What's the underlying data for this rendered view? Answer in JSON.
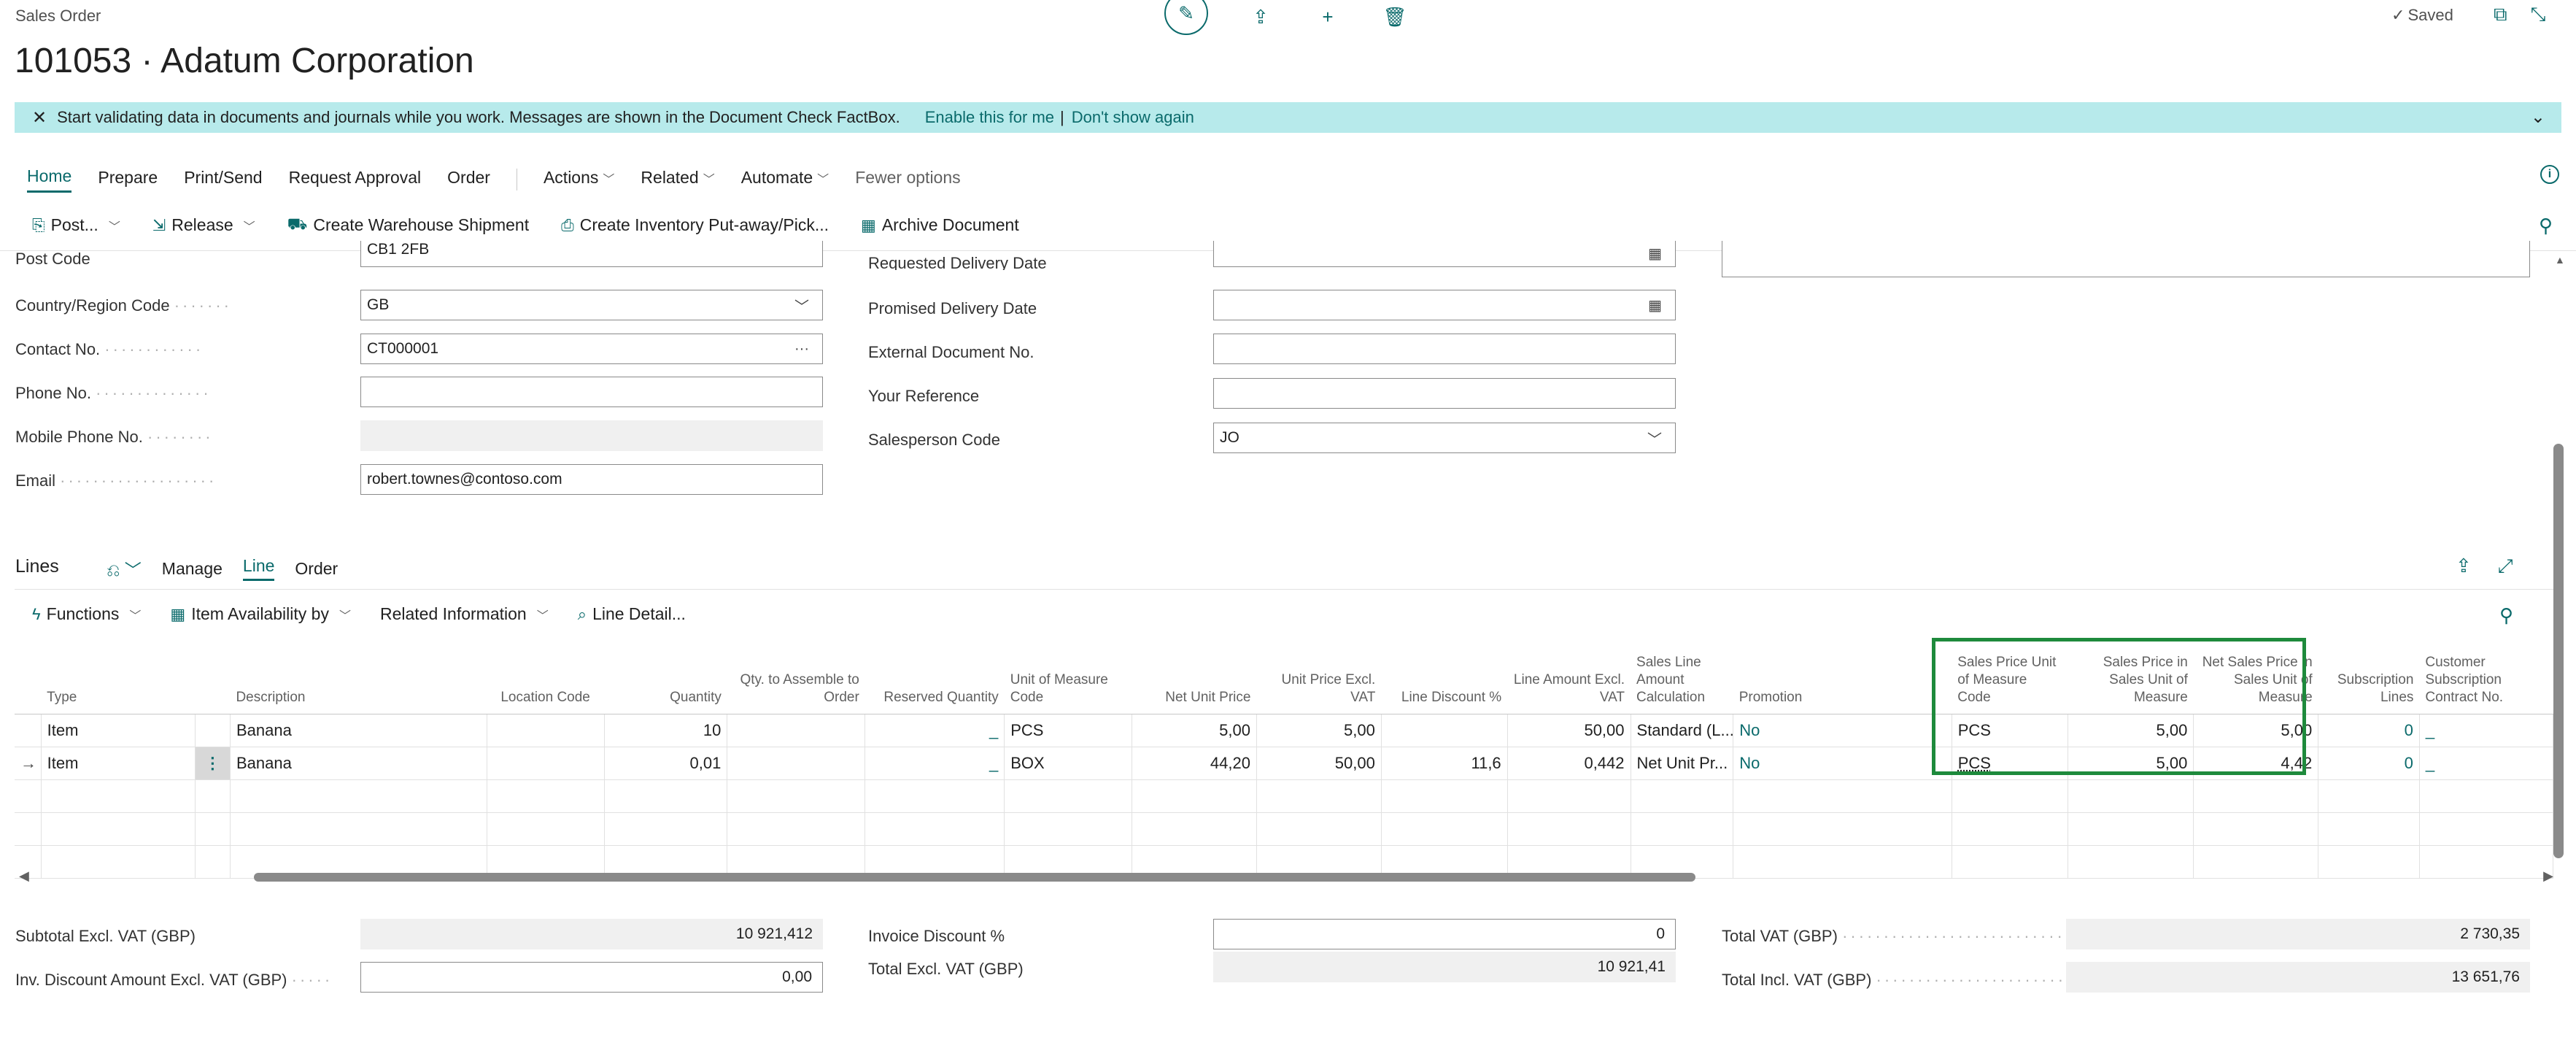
{
  "page": {
    "breadcrumb": "Sales Order",
    "title": "101053 · Adatum Corporation",
    "saved": "Saved"
  },
  "banner": {
    "message": "Start validating data in documents and journals while you work. Messages are shown in the Document Check FactBox.",
    "enable_link": "Enable this for me",
    "separator": "|",
    "dismiss_link": "Don't show again"
  },
  "nav_tabs": [
    "Home",
    "Prepare",
    "Print/Send",
    "Request Approval",
    "Order",
    "Actions",
    "Related",
    "Automate",
    "Fewer options"
  ],
  "toolbar": {
    "post": "Post...",
    "release": "Release",
    "create_shipment": "Create Warehouse Shipment",
    "create_putaway": "Create Inventory Put-away/Pick...",
    "archive": "Archive Document"
  },
  "form": {
    "post_code": {
      "label": "Post Code",
      "value": "CB1 2FB"
    },
    "country": {
      "label": "Country/Region Code",
      "value": "GB"
    },
    "contact": {
      "label": "Contact No.",
      "value": "CT000001"
    },
    "phone": {
      "label": "Phone No.",
      "value": ""
    },
    "mobile": {
      "label": "Mobile Phone No.",
      "value": ""
    },
    "email": {
      "label": "Email",
      "value": "robert.townes@contoso.com"
    },
    "requested_delivery": {
      "label": "Requested Delivery Date",
      "value": ""
    },
    "promised_delivery": {
      "label": "Promised Delivery Date",
      "value": ""
    },
    "external_doc": {
      "label": "External Document No.",
      "value": ""
    },
    "your_ref": {
      "label": "Your Reference",
      "value": ""
    },
    "salesperson": {
      "label": "Salesperson Code",
      "value": "JO"
    }
  },
  "lines": {
    "title": "Lines",
    "tabs": [
      "Manage",
      "Line",
      "Order"
    ],
    "toolbar": {
      "functions": "Functions",
      "item_availability": "Item Availability by",
      "related_info": "Related Information",
      "line_detail": "Line Detail..."
    },
    "columns": [
      "Type",
      "Description",
      "Location Code",
      "Quantity",
      "Qty. to Assemble to Order",
      "Reserved Quantity",
      "Unit of Measure Code",
      "Net Unit Price",
      "Unit Price Excl. VAT",
      "Line Discount %",
      "Line Amount Excl. VAT",
      "Sales Line Amount Calculation",
      "Promotion",
      "Sales Price Unit of Measure Code",
      "Sales Price in Sales Unit of Measure",
      "Net Sales Price in Sales Unit of Measure",
      "Subscription Lines",
      "Customer Subscription Contract No."
    ],
    "rows": [
      {
        "type": "Item",
        "description": "Banana",
        "location": "",
        "quantity": "10",
        "qty_assemble": "",
        "reserved": "_",
        "uom": "PCS",
        "net_unit_price": "5,00",
        "unit_price": "5,00",
        "line_discount": "",
        "line_amount": "50,00",
        "calc": "Standard (L...",
        "promotion": "No",
        "sp_uom": "PCS",
        "sp_sales_uom": "5,00",
        "net_sp_sales_uom": "5,00",
        "subscription_lines": "0",
        "contract_no": "_"
      },
      {
        "type": "Item",
        "description": "Banana",
        "location": "",
        "quantity": "0,01",
        "qty_assemble": "",
        "reserved": "_",
        "uom": "BOX",
        "net_unit_price": "44,20",
        "unit_price": "50,00",
        "line_discount": "11,6",
        "line_amount": "0,442",
        "calc": "Net Unit Pr...",
        "promotion": "No",
        "sp_uom": "PCS",
        "sp_sales_uom": "5,00",
        "net_sp_sales_uom": "4,42",
        "subscription_lines": "0",
        "contract_no": "_"
      }
    ]
  },
  "totals": {
    "subtotal": {
      "label": "Subtotal Excl. VAT (GBP)",
      "value": "10 921,412"
    },
    "inv_discount_amount": {
      "label": "Inv. Discount Amount Excl. VAT (GBP)",
      "value": "0,00"
    },
    "invoice_discount_pct": {
      "label": "Invoice Discount %",
      "value": "0"
    },
    "total_excl_vat": {
      "label": "Total Excl. VAT (GBP)",
      "value": "10 921,41"
    },
    "total_vat": {
      "label": "Total VAT (GBP)",
      "value": "2 730,35"
    },
    "total_incl_vat": {
      "label": "Total Incl. VAT (GBP)",
      "value": "13 651,76"
    }
  },
  "colors": {
    "accent": "#0a6a6b",
    "banner": "#b7eaeb",
    "highlight": "#1e8a3c"
  }
}
